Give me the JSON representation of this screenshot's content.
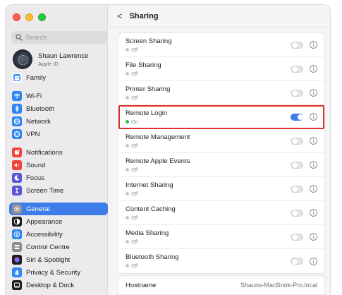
{
  "window": {
    "colors": {
      "red": "#ff5f57",
      "yellow": "#febc2e",
      "green": "#28c840",
      "accent": "#3e7ce9",
      "highlight": "#e0302a"
    }
  },
  "sidebar": {
    "search_placeholder": "Search",
    "profile": {
      "name": "Shaun Lawrence",
      "subtitle": "Apple ID"
    },
    "groups": [
      [
        {
          "label": "Family",
          "icon": "family-icon",
          "color": "#ffffff"
        }
      ],
      [
        {
          "label": "Wi-Fi",
          "icon": "wifi-icon",
          "color": "#2e86f6"
        },
        {
          "label": "Bluetooth",
          "icon": "bluetooth-icon",
          "color": "#2e86f6"
        },
        {
          "label": "Network",
          "icon": "globe-icon",
          "color": "#2e86f6"
        },
        {
          "label": "VPN",
          "icon": "vpn-icon",
          "color": "#2e86f6"
        }
      ],
      [
        {
          "label": "Notifications",
          "icon": "bell-icon",
          "color": "#f0453a"
        },
        {
          "label": "Sound",
          "icon": "speaker-icon",
          "color": "#f0453a"
        },
        {
          "label": "Focus",
          "icon": "moon-icon",
          "color": "#5a56d6"
        },
        {
          "label": "Screen Time",
          "icon": "hourglass-icon",
          "color": "#5a56d6"
        }
      ],
      [
        {
          "label": "General",
          "icon": "gear-icon",
          "color": "#8e8e93",
          "selected": true
        },
        {
          "label": "Appearance",
          "icon": "appearance-icon",
          "color": "#1d1d1f"
        },
        {
          "label": "Accessibility",
          "icon": "accessibility-icon",
          "color": "#2e86f6"
        },
        {
          "label": "Control Centre",
          "icon": "control-centre-icon",
          "color": "#8e8e93"
        },
        {
          "label": "Siri & Spotlight",
          "icon": "siri-icon",
          "color": "#1d1d1f"
        },
        {
          "label": "Privacy & Security",
          "icon": "hand-icon",
          "color": "#2e86f6"
        },
        {
          "label": "Desktop & Dock",
          "icon": "dock-icon",
          "color": "#1d1d1f"
        }
      ]
    ]
  },
  "main": {
    "back_glyph": "<",
    "title": "Sharing",
    "rows": [
      {
        "title": "Screen Sharing",
        "status": "Off",
        "on": false
      },
      {
        "title": "File Sharing",
        "status": "Off",
        "on": false
      },
      {
        "title": "Printer Sharing",
        "status": "Off",
        "on": false
      },
      {
        "title": "Remote Login",
        "status": "On",
        "on": true,
        "highlight": true
      },
      {
        "title": "Remote Management",
        "status": "Off",
        "on": false
      },
      {
        "title": "Remote Apple Events",
        "status": "Off",
        "on": false
      },
      {
        "title": "Internet Sharing",
        "status": "Off",
        "on": false
      },
      {
        "title": "Content Caching",
        "status": "Off",
        "on": false
      },
      {
        "title": "Media Sharing",
        "status": "Off",
        "on": false
      },
      {
        "title": "Bluetooth Sharing",
        "status": "Off",
        "on": false
      }
    ],
    "info_glyph": "i",
    "hostname": {
      "label": "Hostname",
      "value": "Shauns-MacBook-Pro.local"
    }
  }
}
